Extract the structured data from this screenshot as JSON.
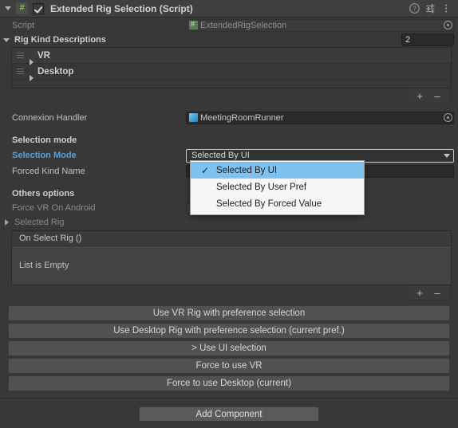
{
  "component": {
    "title": "Extended Rig Selection (Script)",
    "icon": "script-hash-icon",
    "enabled": true,
    "expanded": true,
    "header_icons": [
      "help-icon",
      "preset-icon",
      "more-menu-icon"
    ]
  },
  "script_row": {
    "label": "Script",
    "value": "ExtendedRigSelection",
    "icon": "script-asset-icon"
  },
  "rig_kind_descriptions": {
    "label": "Rig Kind Descriptions",
    "size": "2",
    "items": [
      {
        "label": "VR"
      },
      {
        "label": "Desktop"
      }
    ],
    "add_label": "+",
    "remove_label": "–"
  },
  "connexion_handler": {
    "label": "Connexion Handler",
    "value": "MeetingRoomRunner",
    "icon": "prefab-cube-icon"
  },
  "selection_section": {
    "header": "Selection mode",
    "mode_label": "Selection Mode",
    "mode_value": "Selected By UI",
    "forced_kind_label": "Forced Kind Name",
    "forced_kind_value": ""
  },
  "dropdown": {
    "open": true,
    "options": [
      {
        "label": "Selected By UI",
        "selected": true
      },
      {
        "label": "Selected By User Pref",
        "selected": false
      },
      {
        "label": "Selected By Forced Value",
        "selected": false
      }
    ],
    "check_glyph": "✓",
    "highlight_color": "#7fc2ef"
  },
  "others_section": {
    "header": "Others options",
    "force_vr_label": "Force VR On Android",
    "selected_rig_label": "Selected Rig"
  },
  "on_select_rig": {
    "header": "On Select Rig ()",
    "empty_text": "List is Empty",
    "add_label": "+",
    "remove_label": "–"
  },
  "action_buttons": [
    {
      "label": "Use VR Rig with preference selection"
    },
    {
      "label": "Use Desktop Rig with preference selection (current pref.)"
    },
    {
      "label": "> Use UI selection"
    },
    {
      "label": "Force to use VR"
    },
    {
      "label": "Force to use Desktop  (current)"
    }
  ],
  "footer": {
    "add_component_label": "Add Component"
  }
}
